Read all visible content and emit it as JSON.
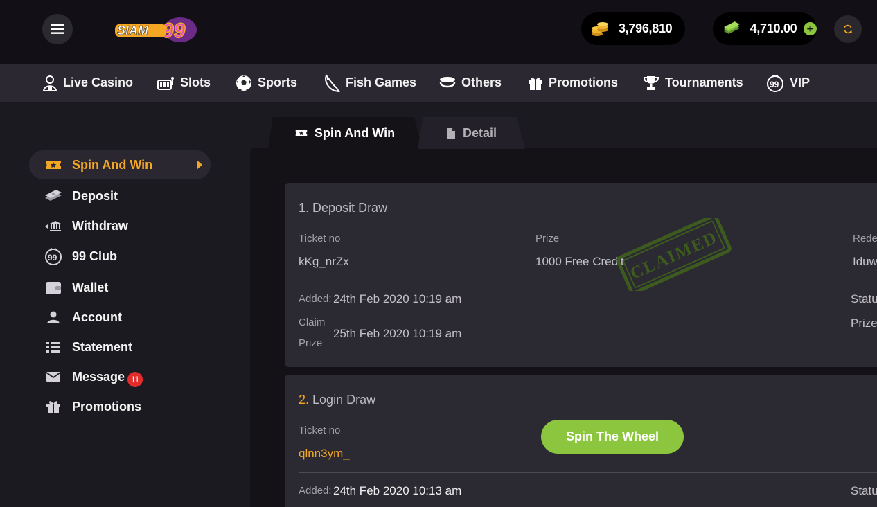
{
  "header": {
    "logo_text": "SIAM99",
    "coins": "3,796,810",
    "cash": "4,710.00",
    "plus": "+"
  },
  "nav": [
    {
      "label": "Live Casino",
      "icon": "live-casino-icon"
    },
    {
      "label": "Slots",
      "icon": "slots-icon"
    },
    {
      "label": "Sports",
      "icon": "soccer-ball-icon"
    },
    {
      "label": "Fish Games",
      "icon": "fish-icon"
    },
    {
      "label": "Others",
      "icon": "others-icon"
    },
    {
      "label": "Promotions",
      "icon": "gift-icon"
    },
    {
      "label": "Tournaments",
      "icon": "trophy-icon"
    },
    {
      "label": "VIP",
      "icon": "vip-icon"
    }
  ],
  "sidebar": {
    "items": [
      {
        "label": "Spin And Win",
        "icon": "ticket-icon",
        "active": true
      },
      {
        "label": "Deposit",
        "icon": "deposit-icon"
      },
      {
        "label": "Withdraw",
        "icon": "withdraw-icon"
      },
      {
        "label": "99 Club",
        "icon": "club-icon"
      },
      {
        "label": "Wallet",
        "icon": "wallet-icon"
      },
      {
        "label": "Account",
        "icon": "user-icon"
      },
      {
        "label": "Statement",
        "icon": "list-icon"
      },
      {
        "label": "Message",
        "icon": "mail-icon",
        "badge": "11"
      },
      {
        "label": "Promotions",
        "icon": "gift-icon"
      }
    ]
  },
  "tabs": {
    "active": "Spin And Win",
    "inactive": "Detail"
  },
  "draws": [
    {
      "number": "1.",
      "name": "Deposit Draw",
      "ticket_label": "Ticket no",
      "ticket": "kKg_nrZx",
      "prize_label": "Prize",
      "prize": "1000 Free Credit",
      "redeem_label": "Rede",
      "redeem": "Iduw",
      "stamp": "CLAIMED",
      "added_label": "Added:",
      "added": "24th Feb 2020 10:19 am",
      "claim_label_1": "Claim",
      "claim_label_2": "Prize",
      "claim": "25th Feb 2020 10:19 am",
      "status_label": "Statu",
      "prize2_label": "Prize"
    },
    {
      "number": "2.",
      "name": "Login Draw",
      "ticket_label": "Ticket no",
      "ticket": "qlnn3ym_",
      "button": "Spin The Wheel",
      "added_label": "Added:",
      "added": "24th Feb 2020 10:13 am",
      "status_label": "Statu"
    }
  ],
  "colors": {
    "accent": "#f5a623",
    "green": "#8cc63f",
    "badge": "#e32d2d",
    "background": "#1c1a21",
    "panel": "#141217"
  }
}
